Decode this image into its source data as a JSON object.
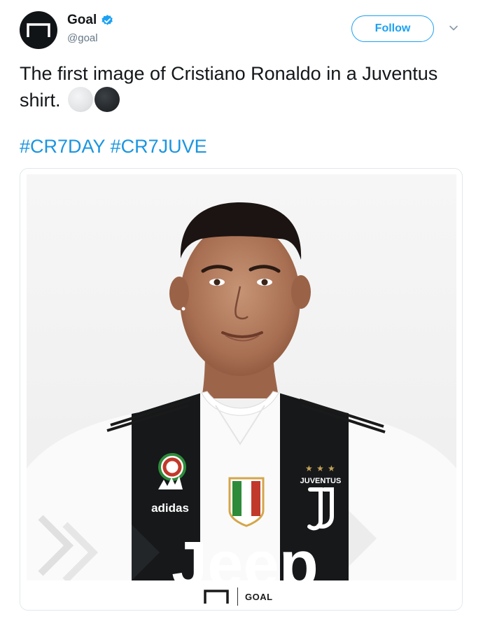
{
  "tweet": {
    "author": {
      "display_name": "Goal",
      "handle": "@goal",
      "verified": true
    },
    "follow_label": "Follow",
    "text": "The first image of Cristiano Ronaldo in a Juventus shirt.",
    "emojis": [
      "white-circle",
      "black-circle"
    ],
    "hashtags": [
      "#CR7DAY",
      "#CR7JUVE"
    ],
    "media": {
      "jersey_text": [
        "JUVENTUS",
        "adidas",
        "Jeep"
      ],
      "watermark": "GOAL"
    }
  },
  "colors": {
    "accent": "#1da1f2",
    "hashtag": "#1b95e0",
    "handle": "#657786",
    "text": "#14171a"
  }
}
